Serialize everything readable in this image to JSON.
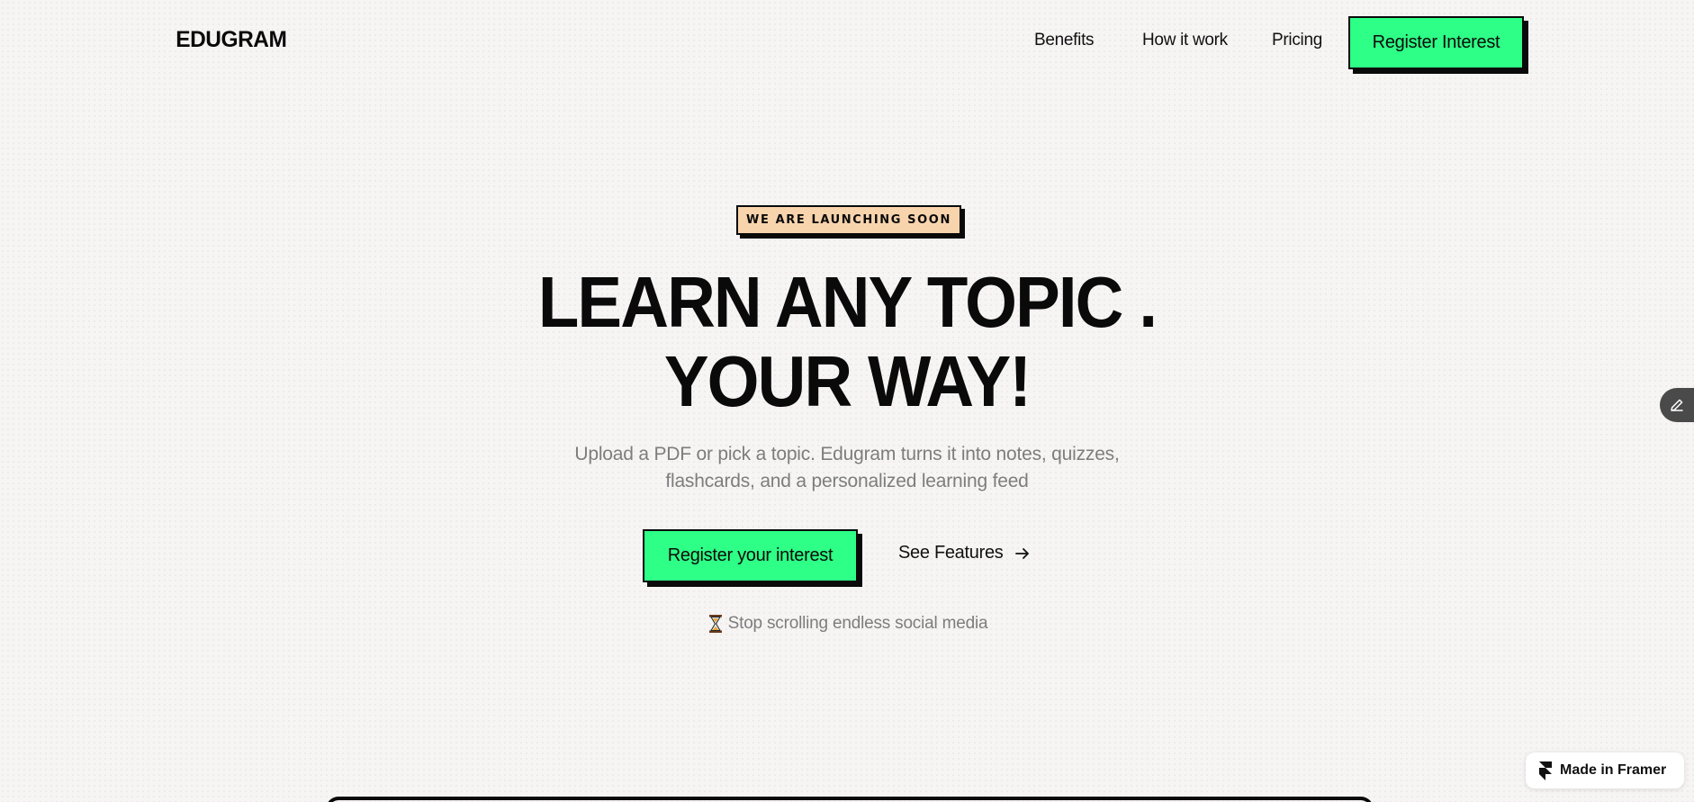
{
  "nav": {
    "logo": "EDUGRAM",
    "links": [
      "Benefits",
      "How it work",
      "Pricing"
    ],
    "cta_label": "Register Interest"
  },
  "hero": {
    "badge": "WE ARE LAUNCHING SOON",
    "headline_line1": "LEARN ANY TOPIC .",
    "headline_line2": "YOUR WAY!",
    "sub_line1": "Upload a PDF or pick a topic. Edugram turns it into notes, quizzes,",
    "sub_line2": "flashcards, and a personalized learning feed",
    "primary_cta": "Register your interest",
    "secondary_cta": "See Features",
    "tagline": "Stop scrolling endless social media"
  },
  "framer_badge": "Made in Framer",
  "colors": {
    "accent_green": "#2eff86",
    "badge_peach": "#f8d4ad",
    "text_dark": "#0a0a0a",
    "text_muted": "#7d7d7d",
    "background": "#f7f4f4"
  },
  "icons": {
    "arrow": "arrow-right-icon",
    "hourglass": "hourglass-icon",
    "edit": "pencil-icon",
    "framer": "framer-logo-icon"
  }
}
